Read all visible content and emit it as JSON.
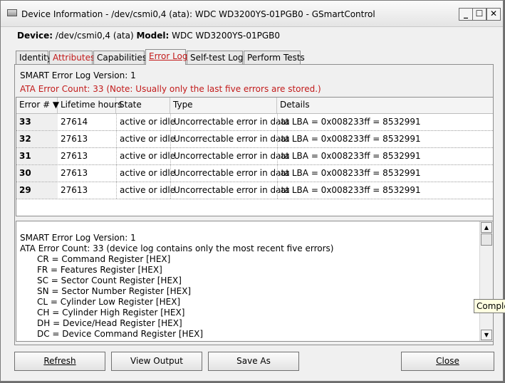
{
  "window": {
    "title": "Device Information - /dev/csmi0,4 (ata): WDC WD3200YS-01PGB0 - GSmartControl",
    "minimize_glyph": "_",
    "maximize_glyph": "☐",
    "close_glyph": "✕"
  },
  "device": {
    "device_label": "Device:",
    "device_value": "/dev/csmi0,4 (ata)",
    "model_label": "Model:",
    "model_value": "WDC WD3200YS-01PGB0"
  },
  "tabs": [
    {
      "label": "Identity"
    },
    {
      "label": "Attributes"
    },
    {
      "label": "Capabilities"
    },
    {
      "label": "Error Log"
    },
    {
      "label": "Self-test Logs"
    },
    {
      "label": "Perform Tests"
    }
  ],
  "error_log": {
    "version_line": "SMART Error Log Version: 1",
    "count_line": "ATA Error Count: 33 (Note: Usually only the last five errors are stored.)",
    "columns": [
      "Error # ▼",
      "Lifetime hours",
      "State",
      "Type",
      "Details"
    ],
    "rows": [
      {
        "num": "33",
        "hours": "27614",
        "state": "active or idle",
        "type": "Uncorrectable error in data",
        "details": "at LBA = 0x008233ff = 8532991"
      },
      {
        "num": "32",
        "hours": "27613",
        "state": "active or idle",
        "type": "Uncorrectable error in data",
        "details": "at LBA = 0x008233ff = 8532991"
      },
      {
        "num": "31",
        "hours": "27613",
        "state": "active or idle",
        "type": "Uncorrectable error in data",
        "details": "at LBA = 0x008233ff = 8532991"
      },
      {
        "num": "30",
        "hours": "27613",
        "state": "active or idle",
        "type": "Uncorrectable error in data",
        "details": "at LBA = 0x008233ff = 8532991"
      },
      {
        "num": "29",
        "hours": "27613",
        "state": "active or idle",
        "type": "Uncorrectable error in data",
        "details": "at LBA = 0x008233ff = 8532991"
      }
    ],
    "text_lines": [
      "SMART Error Log Version: 1",
      "ATA Error Count: 33 (device log contains only the most recent five errors)",
      "CR = Command Register [HEX]",
      "FR = Features Register [HEX]",
      "SC = Sector Count Register [HEX]",
      "SN = Sector Number Register [HEX]",
      "CL = Cylinder Low Register [HEX]",
      "CH = Cylinder High Register [HEX]",
      "DH = Device/Head Register [HEX]",
      "DC = Device Command Register [HEX]"
    ]
  },
  "buttons": {
    "refresh": "Refresh",
    "view_output": "View Output",
    "save_as": "Save As",
    "close": "Close"
  },
  "tooltip": "Comple",
  "colors": {
    "warning_red": "#c21a1a",
    "tab_highlight_red": "#c21a1a"
  }
}
